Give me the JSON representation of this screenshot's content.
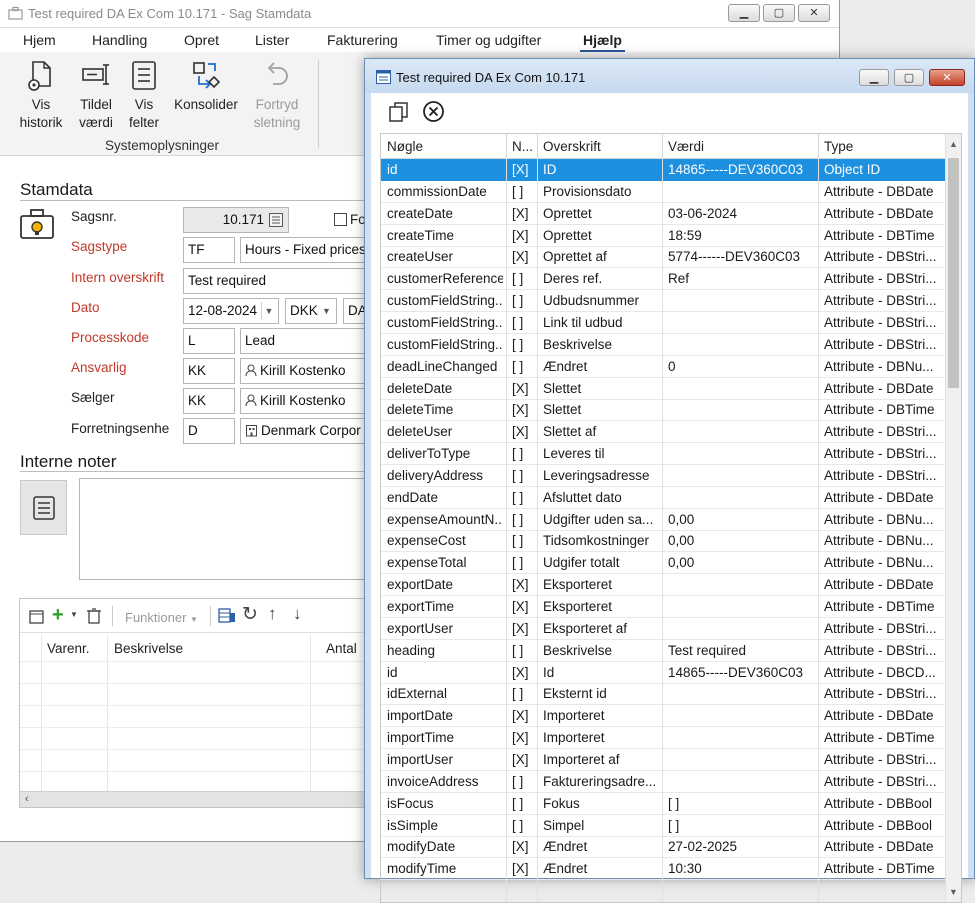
{
  "bg_window": {
    "title": "Test required DA Ex Com 10.171 - Sag Stamdata",
    "menu": [
      "Hjem",
      "Handling",
      "Opret",
      "Lister",
      "Fakturering",
      "Timer og udgifter",
      "Hjælp"
    ],
    "active_menu": "Hjælp",
    "ribbon": {
      "vis_historik": "Vis\nhistorik",
      "tildel_vaerdi": "Tildel\nværdi",
      "vis_felter": "Vis\nfelter",
      "konsolider": "Konsolider",
      "fortryd_sletning": "Fortryd\nsletning",
      "group_label": "Systemoplysninger"
    },
    "stamdata": {
      "title": "Stamdata",
      "labels": {
        "sagsnr": "Sagsnr.",
        "sagstype": "Sagstype",
        "intern_overskrift": "Intern overskrift",
        "dato": "Dato",
        "processkode": "Processkode",
        "ansvarlig": "Ansvarlig",
        "saelger": "Sælger",
        "forretningsenhed": "Forretningsenhe"
      },
      "values": {
        "sagsnr": "10.171",
        "fo_checkbox_label": "Fo",
        "sagstype_code": "TF",
        "sagstype_name": "Hours - Fixed prices",
        "intern_overskrift": "Test required",
        "dato": "12-08-2024",
        "currency": "DKK",
        "language": "DA",
        "processkode_code": "L",
        "processkode_name": "Lead",
        "ansvarlig_code": "KK",
        "ansvarlig_name": "Kirill Kostenko",
        "saelger_code": "KK",
        "saelger_name": "Kirill Kostenko",
        "forretningsenhed_code": "D",
        "forretningsenhed_name": "Denmark Corpor"
      }
    },
    "notes_title": "Interne noter",
    "items": {
      "funktioner": "Funktioner",
      "columns": [
        "Varenr.",
        "Beskrivelse",
        "Antal"
      ]
    }
  },
  "dialog": {
    "title": "Test required DA Ex Com 10.171",
    "columns": [
      "Nøgle",
      "N...",
      "Overskrift",
      "Værdi",
      "Type"
    ],
    "rows": [
      {
        "key": "id",
        "n": "[X]",
        "heading": "ID",
        "value": "14865-----DEV360C03",
        "type": "Object ID",
        "selected": true
      },
      {
        "key": "commissionDate",
        "n": "[ ]",
        "heading": "Provisionsdato",
        "value": "",
        "type": "Attribute - DBDate"
      },
      {
        "key": "createDate",
        "n": "[X]",
        "heading": "Oprettet",
        "value": "03-06-2024",
        "type": "Attribute - DBDate"
      },
      {
        "key": "createTime",
        "n": "[X]",
        "heading": "Oprettet",
        "value": "18:59",
        "type": "Attribute - DBTime"
      },
      {
        "key": "createUser",
        "n": "[X]",
        "heading": "Oprettet af",
        "value": "5774------DEV360C03",
        "type": "Attribute - DBStri..."
      },
      {
        "key": "customerReference",
        "n": "[ ]",
        "heading": "Deres ref.",
        "value": "Ref",
        "type": "Attribute - DBStri..."
      },
      {
        "key": "customFieldString...",
        "n": "[ ]",
        "heading": "Udbudsnummer",
        "value": "",
        "type": "Attribute - DBStri..."
      },
      {
        "key": "customFieldString...",
        "n": "[ ]",
        "heading": "Link til udbud",
        "value": "",
        "type": "Attribute - DBStri..."
      },
      {
        "key": "customFieldString...",
        "n": "[ ]",
        "heading": "Beskrivelse",
        "value": "",
        "type": "Attribute - DBStri..."
      },
      {
        "key": "deadLineChanged",
        "n": "[ ]",
        "heading": "Ændret",
        "value": "0",
        "type": "Attribute - DBNu..."
      },
      {
        "key": "deleteDate",
        "n": "[X]",
        "heading": "Slettet",
        "value": "",
        "type": "Attribute - DBDate"
      },
      {
        "key": "deleteTime",
        "n": "[X]",
        "heading": "Slettet",
        "value": "",
        "type": "Attribute - DBTime"
      },
      {
        "key": "deleteUser",
        "n": "[X]",
        "heading": "Slettet af",
        "value": "",
        "type": "Attribute - DBStri..."
      },
      {
        "key": "deliverToType",
        "n": "[ ]",
        "heading": "Leveres til",
        "value": "",
        "type": "Attribute - DBStri..."
      },
      {
        "key": "deliveryAddress",
        "n": "[ ]",
        "heading": "Leveringsadresse",
        "value": "",
        "type": "Attribute - DBStri..."
      },
      {
        "key": "endDate",
        "n": "[ ]",
        "heading": "Afsluttet dato",
        "value": "",
        "type": "Attribute - DBDate"
      },
      {
        "key": "expenseAmountN...",
        "n": "[ ]",
        "heading": "Udgifter uden sa...",
        "value": "0,00",
        "type": "Attribute - DBNu..."
      },
      {
        "key": "expenseCost",
        "n": "[ ]",
        "heading": "Tidsomkostninger",
        "value": "0,00",
        "type": "Attribute - DBNu..."
      },
      {
        "key": "expenseTotal",
        "n": "[ ]",
        "heading": "Udgifer totalt",
        "value": "0,00",
        "type": "Attribute - DBNu..."
      },
      {
        "key": "exportDate",
        "n": "[X]",
        "heading": "Eksporteret",
        "value": "",
        "type": "Attribute - DBDate"
      },
      {
        "key": "exportTime",
        "n": "[X]",
        "heading": "Eksporteret",
        "value": "",
        "type": "Attribute - DBTime"
      },
      {
        "key": "exportUser",
        "n": "[X]",
        "heading": "Eksporteret af",
        "value": "",
        "type": "Attribute - DBStri..."
      },
      {
        "key": "heading",
        "n": "[ ]",
        "heading": "Beskrivelse",
        "value": "Test required",
        "type": "Attribute - DBStri..."
      },
      {
        "key": "id",
        "n": "[X]",
        "heading": "Id",
        "value": "14865-----DEV360C03",
        "type": "Attribute - DBCD..."
      },
      {
        "key": "idExternal",
        "n": "[ ]",
        "heading": "Eksternt id",
        "value": "",
        "type": "Attribute - DBStri..."
      },
      {
        "key": "importDate",
        "n": "[X]",
        "heading": "Importeret",
        "value": "",
        "type": "Attribute - DBDate"
      },
      {
        "key": "importTime",
        "n": "[X]",
        "heading": "Importeret",
        "value": "",
        "type": "Attribute - DBTime"
      },
      {
        "key": "importUser",
        "n": "[X]",
        "heading": "Importeret af",
        "value": "",
        "type": "Attribute - DBStri..."
      },
      {
        "key": "invoiceAddress",
        "n": "[ ]",
        "heading": "Faktureringsadre...",
        "value": "",
        "type": "Attribute - DBStri..."
      },
      {
        "key": "isFocus",
        "n": "[ ]",
        "heading": "Fokus",
        "value": "[ ]",
        "type": "Attribute - DBBool"
      },
      {
        "key": "isSimple",
        "n": "[ ]",
        "heading": "Simpel",
        "value": "[ ]",
        "type": "Attribute - DBBool"
      },
      {
        "key": "modifyDate",
        "n": "[X]",
        "heading": "Ændret",
        "value": "27-02-2025",
        "type": "Attribute - DBDate"
      },
      {
        "key": "modifyTime",
        "n": "[X]",
        "heading": "Ændret",
        "value": "10:30",
        "type": "Attribute - DBTime"
      }
    ]
  },
  "colors": {
    "selection": "#1e90e0",
    "required_label": "#c0392b",
    "dialog_frame": "#cfe0f3",
    "close_button": "#c4412a"
  }
}
